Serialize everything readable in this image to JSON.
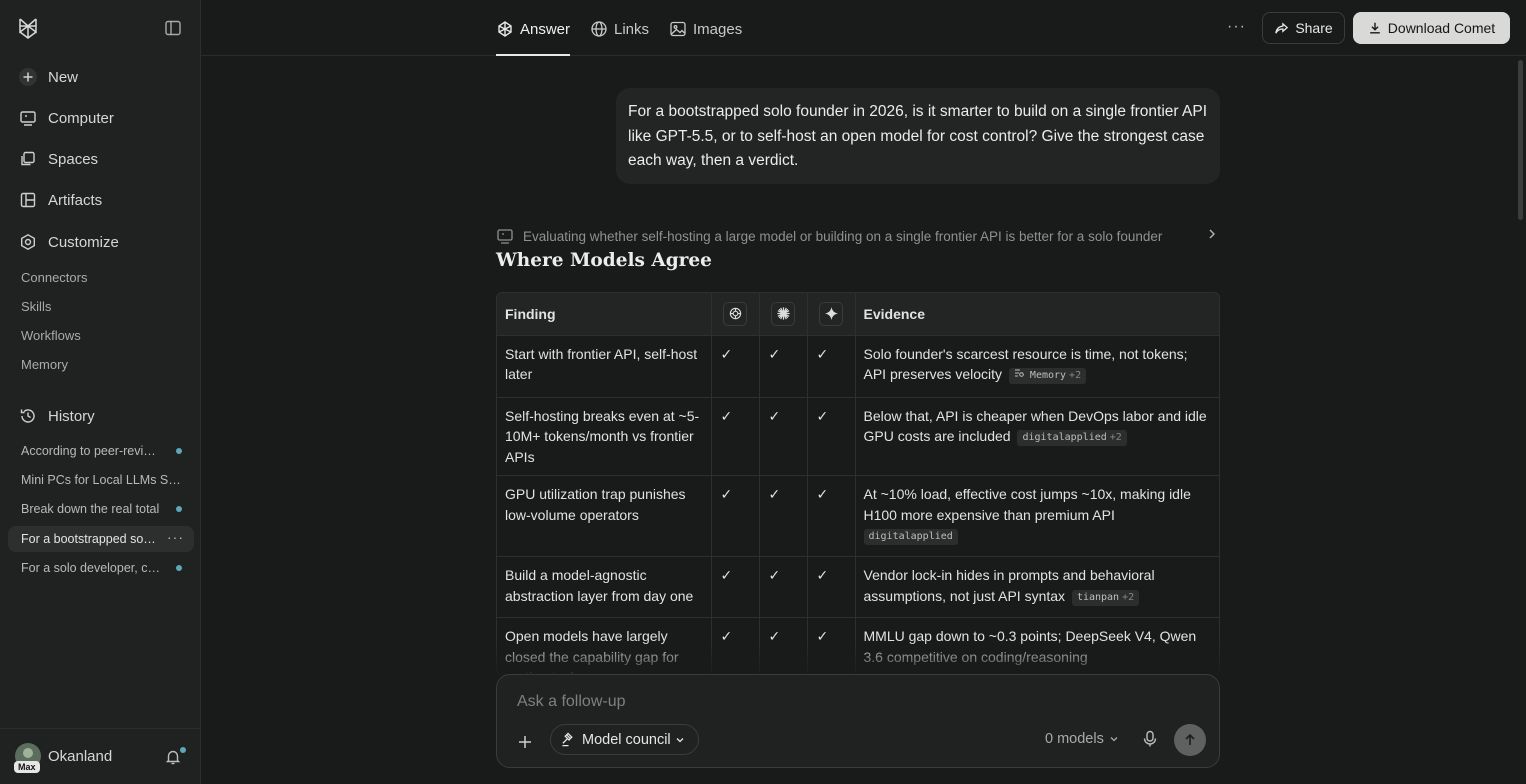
{
  "sidebar": {
    "nav": [
      {
        "label": "New",
        "icon": "plus-icon"
      },
      {
        "label": "Computer",
        "icon": "computer-icon"
      },
      {
        "label": "Spaces",
        "icon": "spaces-icon"
      },
      {
        "label": "Artifacts",
        "icon": "artifacts-icon"
      },
      {
        "label": "Customize",
        "icon": "customize-icon"
      }
    ],
    "sub_items": [
      "Connectors",
      "Skills",
      "Workflows",
      "Memory"
    ],
    "history_label": "History",
    "history": [
      {
        "title": "According to peer-reviewed",
        "dot": true
      },
      {
        "title": "Mini PCs for Local LLMs Spring",
        "dot": false
      },
      {
        "title": "Break down the real total",
        "dot": true
      },
      {
        "title": "For a bootstrapped solo founder",
        "dot": false,
        "active": true
      },
      {
        "title": "For a solo developer, comparing",
        "dot": true
      }
    ],
    "user": {
      "name": "Okanland",
      "badge": "Max"
    }
  },
  "topbar": {
    "tabs": [
      {
        "label": "Answer",
        "icon": "answer-icon",
        "active": true
      },
      {
        "label": "Links",
        "icon": "globe-icon"
      },
      {
        "label": "Images",
        "icon": "image-icon"
      }
    ],
    "share_label": "Share",
    "download_label": "Download Comet"
  },
  "thread": {
    "query": "For a bootstrapped solo founder in 2026, is it smarter to build on a single frontier API like GPT-5.5, or to self-host an open model for cost control? Give the strongest case each way, then a verdict.",
    "step": "Evaluating whether self-hosting a large model or building on a single frontier API is better for a solo founder",
    "heading": "Where Models Agree"
  },
  "table": {
    "headers": {
      "finding": "Finding",
      "evidence": "Evidence"
    },
    "model_icons": [
      "openai-icon",
      "claude-icon",
      "gemini-icon"
    ],
    "check": "✓",
    "rows": [
      {
        "finding": "Start with frontier API, self-host later",
        "evidence": "Solo founder's scarcest resource is time, not tokens; API preserves velocity",
        "source": "Memory",
        "extra": "+2",
        "source_icon": true
      },
      {
        "finding": "Self-hosting breaks even at ~5-10M+ tokens/month vs frontier APIs",
        "evidence": "Below that, API is cheaper when DevOps labor and idle GPU costs are included",
        "source": "digitalapplied",
        "extra": "+2"
      },
      {
        "finding": "GPU utilization trap punishes low-volume operators",
        "evidence": "At ~10% load, effective cost jumps ~10x, making idle H100 more expensive than premium API",
        "source": "digitalapplied",
        "extra": ""
      },
      {
        "finding": "Build a model-agnostic abstraction layer from day one",
        "evidence": "Vendor lock-in hides in prompts and behavioral assumptions, not just API syntax",
        "source": "tianpan",
        "extra": "+2"
      },
      {
        "finding": "Open models have largely closed the capability gap for routine tasks",
        "evidence": "MMLU gap down to ~0.3 points; DeepSeek V4, Qwen 3.6 competitive on coding/reasoning",
        "source": "",
        "extra": ""
      }
    ]
  },
  "composer": {
    "placeholder": "Ask a follow-up",
    "council_label": "Model council",
    "models_label": "0 models"
  }
}
